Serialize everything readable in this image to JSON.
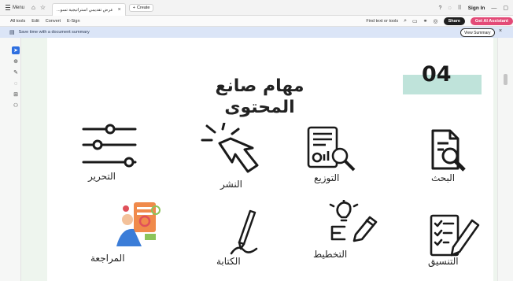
{
  "tabbar": {
    "menu_label": "Menu",
    "tab_title": "عرض تقديمي استراتيجية تسو...",
    "new_tab_label": "Create",
    "sign_in": "Sign In"
  },
  "toolbar": {
    "menu_items": [
      "All tools",
      "Edit",
      "Convert",
      "E-Sign"
    ],
    "find_text": "Find text or tools",
    "share_label": "Share",
    "ai_label": "Get AI Assistant"
  },
  "banner": {
    "text": "Save time with a document summary",
    "button": "View Summary"
  },
  "slide": {
    "number": "04",
    "title_line1": "مهام صانع",
    "title_line2": "المحتوى",
    "tasks": {
      "editing": "التحرير",
      "publishing": "النشر",
      "distribution": "التوزيع",
      "research": "البحث",
      "review": "المراجعة",
      "writing": "الكتابة",
      "planning": "التخطيط",
      "coordination": "التنسيق"
    }
  },
  "colors": {
    "accent_bar": "#bfe3da",
    "share": "#1f1f1f",
    "ai": "#e34a77",
    "banner": "#dbe5f7",
    "rail_active": "#2f6fe0"
  }
}
